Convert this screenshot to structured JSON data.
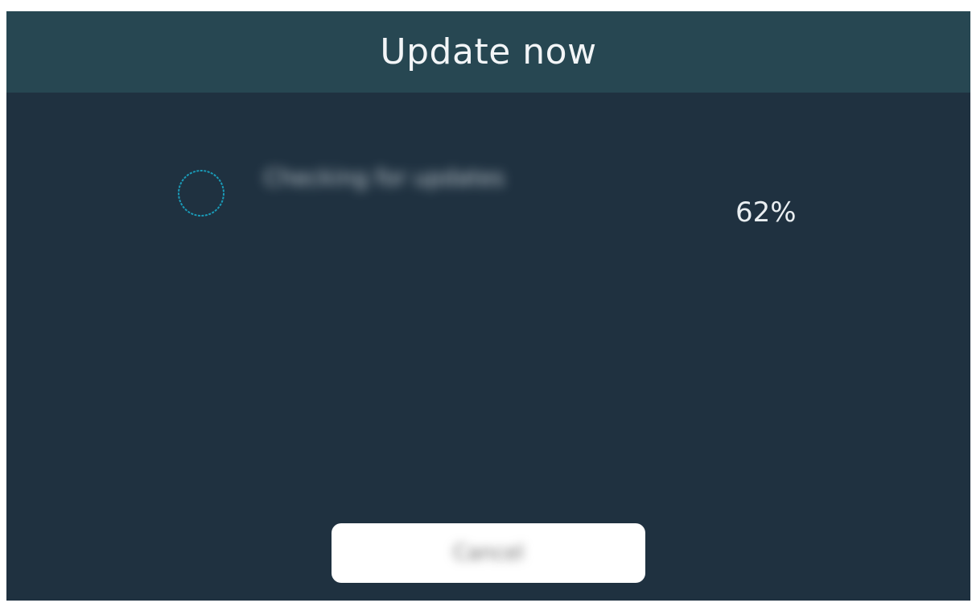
{
  "dialog": {
    "title": "Update now",
    "status_text": "Checking for updates",
    "progress_percent_label": "62%",
    "progress_fraction": 0.62,
    "cancel_label": "Cancel"
  },
  "icons": {
    "spinner": "loading-spinner-icon"
  },
  "colors": {
    "header_bg": "#274752",
    "body_bg": "#1f3140",
    "spinner_accent": "#1aa6c4",
    "button_bg": "#ffffff"
  }
}
